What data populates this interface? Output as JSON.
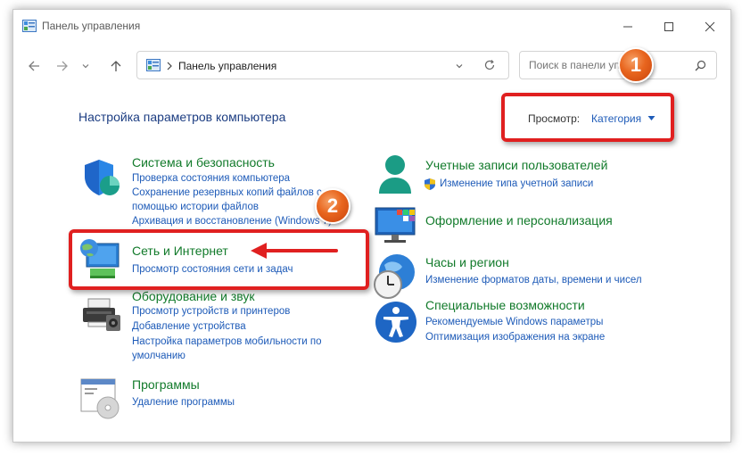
{
  "window": {
    "title": "Панель управления",
    "controls": [
      "minimize-icon",
      "maximize-icon",
      "close-icon"
    ]
  },
  "address_bar": {
    "crumb": "Панель управления"
  },
  "search": {
    "placeholder": "Поиск в панели упра"
  },
  "main": {
    "page_title": "Настройка параметров компьютера",
    "view_by_label": "Просмотр:",
    "view_by_value": "Категория"
  },
  "categories": [
    {
      "title": "Система и безопасность",
      "links": [
        "Проверка состояния компьютера",
        "Сохранение резервных копий файлов с",
        "помощью истории файлов",
        "Архивация и восстановление (Windows 7)"
      ]
    },
    {
      "title": "Сеть и Интернет",
      "links": [
        "Просмотр состояния сети и задач"
      ]
    },
    {
      "title": "Оборудование и звук",
      "links": [
        "Просмотр устройств и принтеров",
        "Добавление устройства",
        "Настройка параметров мобильности по",
        "умолчанию"
      ]
    },
    {
      "title": "Программы",
      "links": [
        "Удаление программы"
      ]
    },
    {
      "title": "Учетные записи пользователей",
      "links": [
        "Изменение типа учетной записи"
      ]
    },
    {
      "title": "Оформление и персонализация",
      "links": []
    },
    {
      "title": "Часы и регион",
      "links": [
        "Изменение форматов даты, времени и чисел"
      ]
    },
    {
      "title": "Специальные возможности",
      "links": [
        "Рекомендуемые Windows параметры",
        "Оптимизация изображения на экране"
      ]
    }
  ],
  "annotations": {
    "badge_1": "1",
    "badge_2": "2",
    "highlight_color": "#e02020",
    "badge_color": "#e8651e"
  }
}
